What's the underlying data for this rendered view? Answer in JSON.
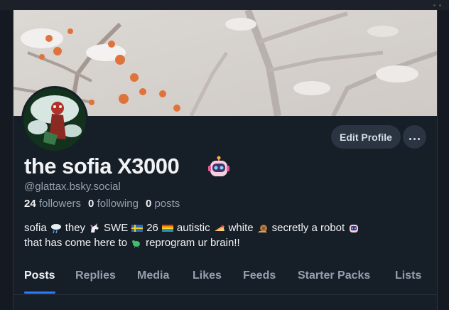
{
  "profile": {
    "display_name": "the sofia X3000",
    "handle": "@glattax.bsky.social",
    "stats": {
      "followers_count": "24",
      "followers_label": "followers",
      "following_count": "0",
      "following_label": "following",
      "posts_count": "0",
      "posts_label": "posts"
    },
    "bio": {
      "line1": {
        "t1": "sofia",
        "t2": "they",
        "t3": "SWE",
        "t4": "26",
        "t5": "autistic",
        "t6": "white",
        "t7": "secretly a robot"
      },
      "line2": {
        "t1": "that has come here to",
        "t2": "reprogram ur brain!!"
      }
    }
  },
  "actions": {
    "edit_profile_label": "Edit Profile"
  },
  "tabs": [
    "Posts",
    "Replies",
    "Media",
    "Likes",
    "Feeds",
    "Starter Packs",
    "Lists"
  ],
  "active_tab": "Posts",
  "colors": {
    "background": "#161e27",
    "accent": "#2e7cf6",
    "button_bg": "#2a3443",
    "muted_text": "#94a0ae"
  }
}
